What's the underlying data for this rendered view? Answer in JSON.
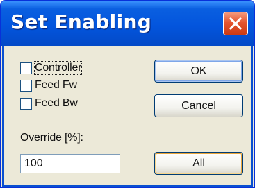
{
  "window": {
    "title": "Set Enabling"
  },
  "options": [
    {
      "label": "Controller",
      "checked": false
    },
    {
      "label": "Feed Fw",
      "checked": false
    },
    {
      "label": "Feed Bw",
      "checked": false
    }
  ],
  "buttons": {
    "ok_label": "OK",
    "cancel_label": "Cancel",
    "all_label": "All"
  },
  "override": {
    "label": "Override [%]:",
    "value": "100"
  },
  "icons": {
    "close": "close-icon"
  },
  "colors": {
    "titlebar": "#0355dd",
    "close_button": "#e5552f",
    "dialog_background": "#ece9d8"
  }
}
